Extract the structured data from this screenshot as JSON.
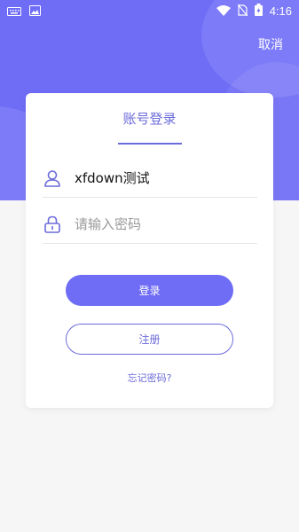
{
  "colors": {
    "accent": "#6f6cf6",
    "accent_text": "#6b6bd9",
    "background": "#f6f6f6",
    "card": "#ffffff"
  },
  "status_bar": {
    "time": "4:16",
    "left_icons": [
      "keyboard-icon",
      "image-icon"
    ],
    "right_icons": [
      "wifi-icon",
      "no-sim-icon",
      "battery-charging-icon"
    ]
  },
  "header": {
    "cancel_label": "取消"
  },
  "login_card": {
    "title": "账号登录",
    "username": {
      "icon": "user-icon",
      "value": "xfdown测试"
    },
    "password": {
      "icon": "lock-icon",
      "placeholder": "请输入密码"
    },
    "login_button": "登录",
    "register_button": "注册",
    "forgot_password": "忘记密码?"
  }
}
